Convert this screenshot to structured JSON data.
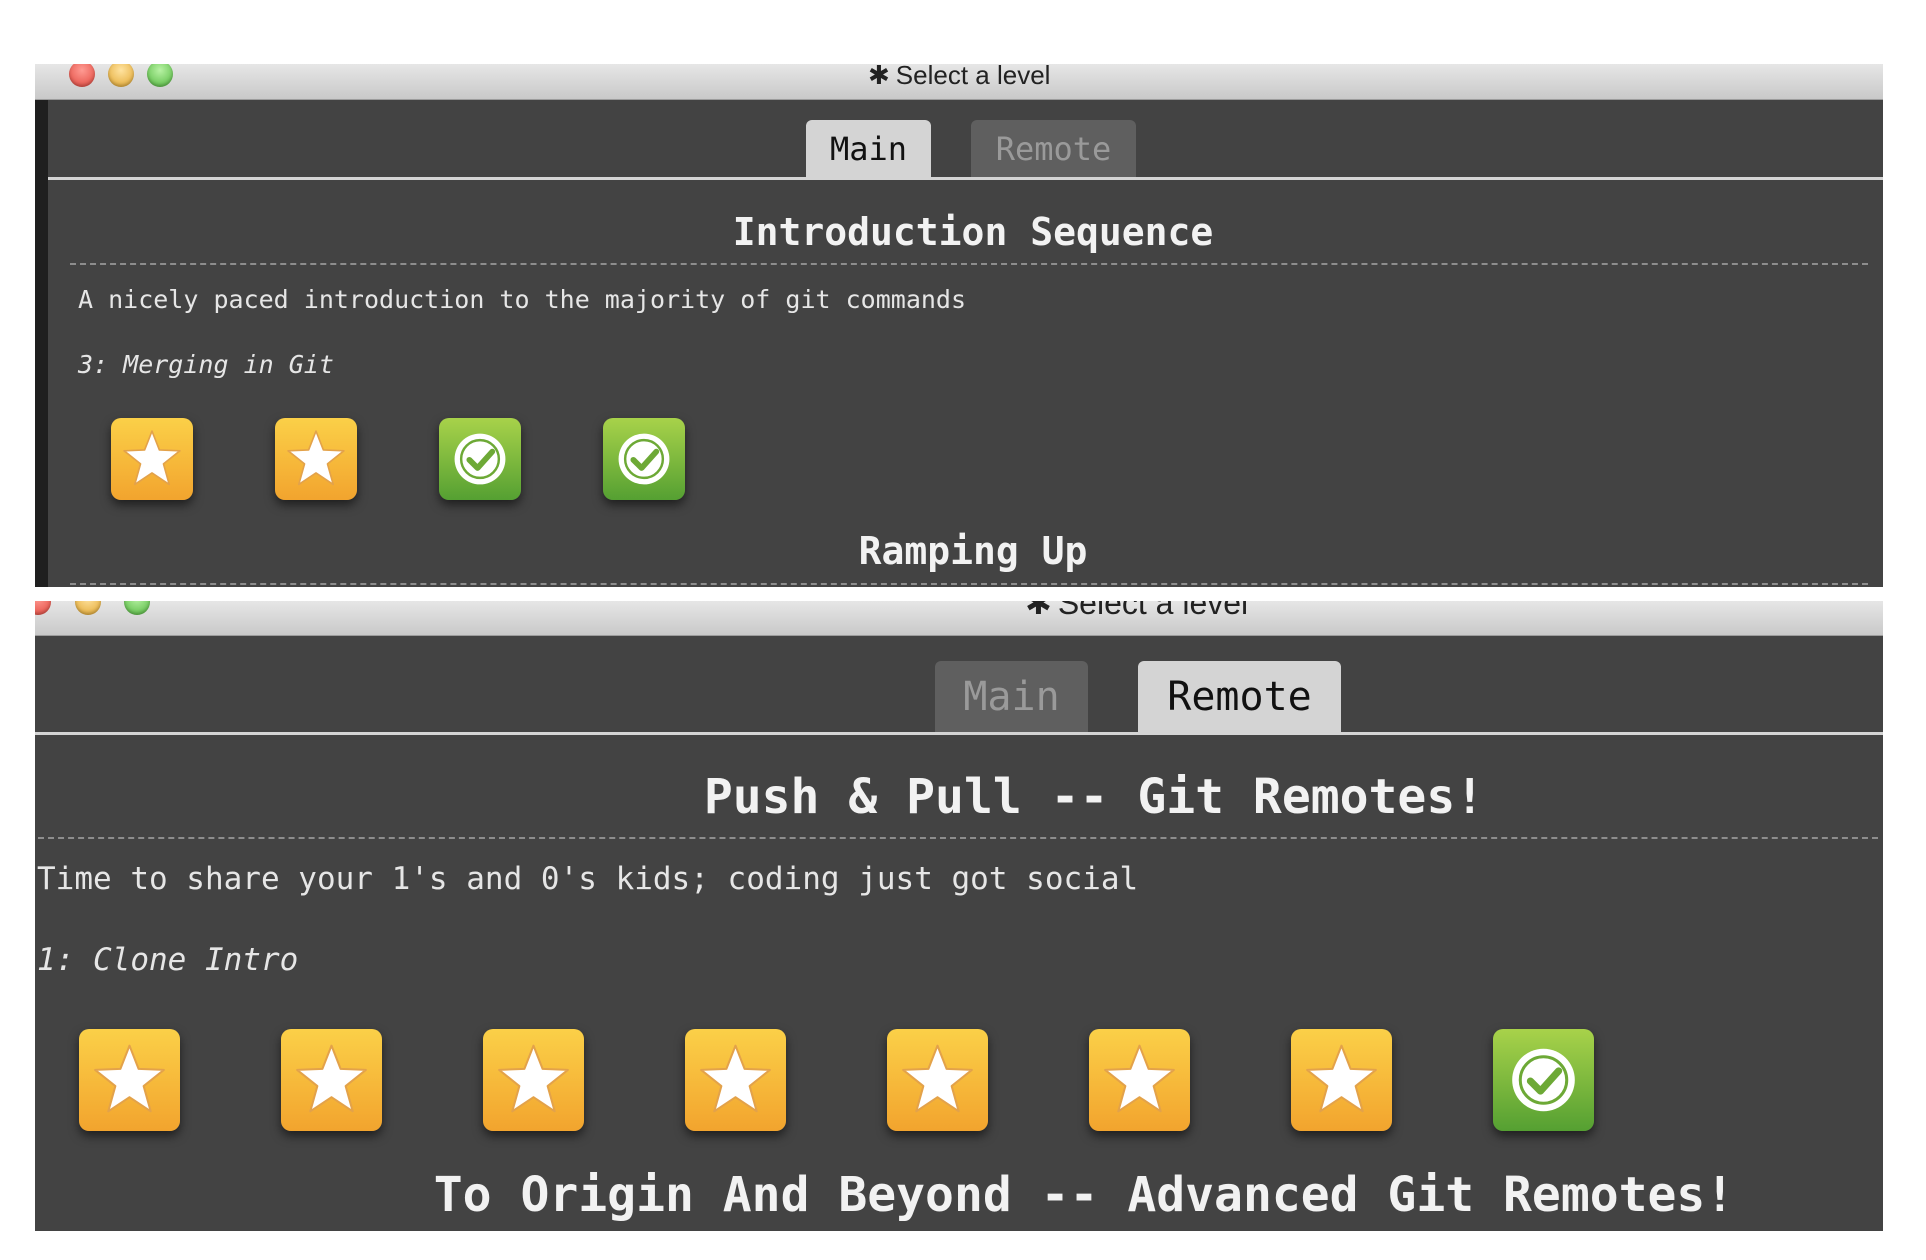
{
  "windows": [
    {
      "title": "Select a level",
      "title_icon": "gear-icon",
      "tabs": [
        {
          "label": "Main",
          "active": true
        },
        {
          "label": "Remote",
          "active": false
        }
      ],
      "sequence": {
        "title": "Introduction Sequence",
        "description": "A nicely paced introduction to the majority of git commands",
        "selected_level": "3: Merging in Git",
        "levels": [
          "star-icon",
          "star-icon",
          "check-icon",
          "check-icon"
        ]
      },
      "next_sequence_title": "Ramping Up"
    },
    {
      "title": "Select a level",
      "title_icon": "gear-icon",
      "tabs": [
        {
          "label": "Main",
          "active": false
        },
        {
          "label": "Remote",
          "active": true
        }
      ],
      "sequence": {
        "title": "Push & Pull -- Git Remotes!",
        "description": "Time to share your 1's and 0's kids; coding just got social",
        "selected_level": "1: Clone Intro",
        "levels": [
          "star-icon",
          "star-icon",
          "star-icon",
          "star-icon",
          "star-icon",
          "star-icon",
          "star-icon",
          "check-icon"
        ]
      },
      "next_sequence_title": "To Origin And Beyond -- Advanced Git Remotes!"
    }
  ],
  "colors": {
    "window_bg": "#434343",
    "tab_active": "#d4d4d4",
    "tab_inactive": "#5f5f5f",
    "star_icon": "#f6b83a",
    "check_icon": "#6fb83a"
  }
}
